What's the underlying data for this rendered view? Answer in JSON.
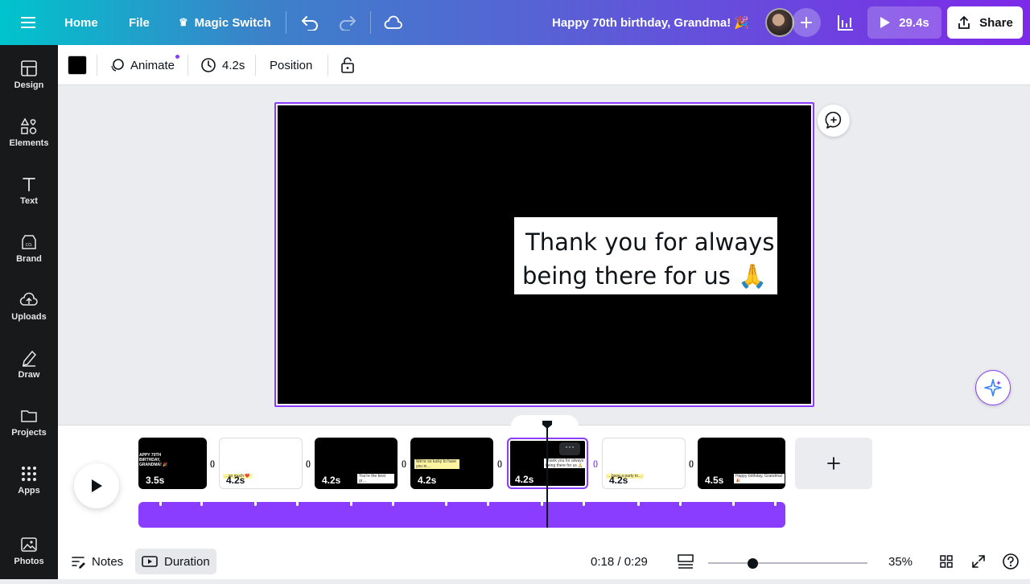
{
  "topbar": {
    "home_label": "Home",
    "file_label": "File",
    "magic_switch_label": "Magic Switch",
    "doc_title": "Happy 70th birthday, Grandma! 🎉",
    "play_duration": "29.4s",
    "share_label": "Share"
  },
  "sidebar": {
    "items": [
      {
        "label": "Design",
        "icon": "design-icon"
      },
      {
        "label": "Elements",
        "icon": "elements-icon"
      },
      {
        "label": "Text",
        "icon": "text-icon"
      },
      {
        "label": "Brand",
        "icon": "brand-icon"
      },
      {
        "label": "Uploads",
        "icon": "uploads-icon"
      },
      {
        "label": "Draw",
        "icon": "draw-icon"
      },
      {
        "label": "Projects",
        "icon": "projects-icon"
      },
      {
        "label": "Apps",
        "icon": "apps-icon"
      },
      {
        "label": "Photos",
        "icon": "photos-icon"
      }
    ]
  },
  "context_toolbar": {
    "color_swatch": "#000000",
    "animate_label": "Animate",
    "duration_label": "4.2s",
    "position_label": "Position"
  },
  "canvas": {
    "text_line1": "Thank you for always",
    "text_line2": "being there for us 🙏"
  },
  "timeline": {
    "clips": [
      {
        "duration": "3.5s",
        "bg": "black",
        "preview": "APPY 70TH BIRTHDAY, GRANDMA! 🎉"
      },
      {
        "duration": "4.2s",
        "bg": "white",
        "preview": "…so much ❤️"
      },
      {
        "duration": "4.2s",
        "bg": "black",
        "preview": "You're the best gr…"
      },
      {
        "duration": "4.2s",
        "bg": "black",
        "preview": "We're so lucky to have you in…"
      },
      {
        "duration": "4.2s",
        "bg": "black",
        "preview": "Thank you for always being there for us 🙏",
        "selected": true
      },
      {
        "duration": "4.2s",
        "bg": "white",
        "preview": "…have a party to…"
      },
      {
        "duration": "4.5s",
        "bg": "black",
        "preview": "Happy birthday, Grandma! 🎉"
      }
    ]
  },
  "footer": {
    "notes_label": "Notes",
    "duration_label": "Duration",
    "time_display": "0:18 / 0:29",
    "zoom_label": "35%",
    "zoom_fraction": 0.28
  },
  "colors": {
    "accent": "#8b3dff",
    "topbar_start": "#00c4cc",
    "topbar_end": "#7d2ae8",
    "sidebar_bg": "#18191b"
  }
}
